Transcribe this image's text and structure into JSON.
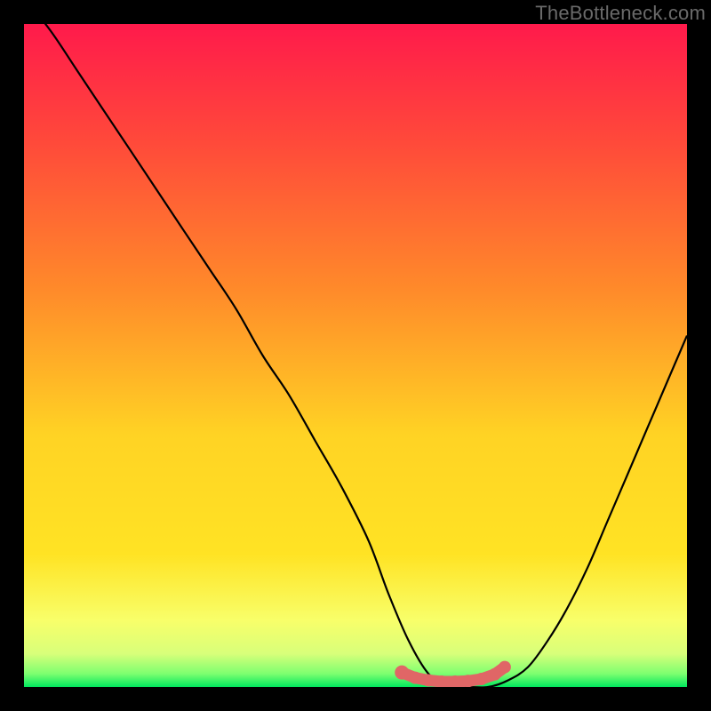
{
  "watermark": "TheBottleneck.com",
  "colors": {
    "gradient_top": "#ff1a4b",
    "gradient_mid1": "#ff8a2a",
    "gradient_mid2": "#ffe324",
    "gradient_low": "#f8ff6a",
    "gradient_band": "#d8ff7a",
    "gradient_bottom": "#00e85e",
    "curve": "#000000",
    "marker_fill": "#e06666",
    "marker_stroke": "#cc5555"
  },
  "chart_data": {
    "type": "line",
    "title": "",
    "xlabel": "",
    "ylabel": "",
    "xlim": [
      0,
      100
    ],
    "ylim": [
      0,
      100
    ],
    "series": [
      {
        "name": "bottleneck-curve",
        "x": [
          0,
          4,
          8,
          12,
          16,
          20,
          24,
          28,
          32,
          36,
          40,
          44,
          48,
          52,
          55,
          58,
          61,
          64,
          67,
          70,
          73,
          76,
          79,
          82,
          85,
          88,
          91,
          94,
          97,
          100
        ],
        "y": [
          104,
          99,
          93,
          87,
          81,
          75,
          69,
          63,
          57,
          50,
          44,
          37,
          30,
          22,
          14,
          7,
          2,
          0,
          0,
          0,
          1,
          3,
          7,
          12,
          18,
          25,
          32,
          39,
          46,
          53
        ]
      }
    ],
    "markers": {
      "name": "optimal-range",
      "x": [
        57,
        59,
        61,
        63,
        65,
        67,
        69,
        71,
        72.5
      ],
      "y": [
        2.2,
        1.4,
        1.0,
        0.8,
        0.8,
        0.9,
        1.2,
        1.9,
        3.0
      ]
    }
  }
}
